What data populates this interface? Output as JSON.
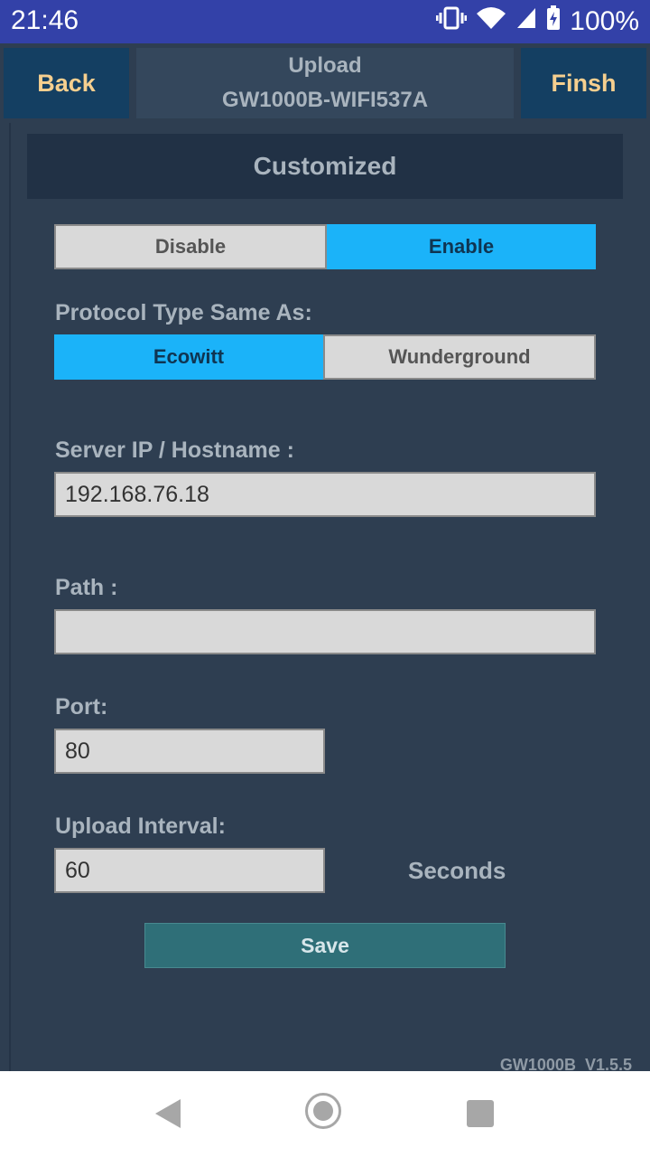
{
  "status_bar": {
    "time": "21:46",
    "battery": "100%"
  },
  "header": {
    "back_label": "Back",
    "title_line1": "Upload",
    "title_line2": "GW1000B-WIFI537A",
    "finish_label": "Finsh"
  },
  "section": {
    "title": "Customized"
  },
  "enable_toggle": {
    "disable_label": "Disable",
    "enable_label": "Enable",
    "selected": "Enable"
  },
  "protocol": {
    "label": "Protocol Type Same As:",
    "options": [
      "Ecowitt",
      "Wunderground"
    ],
    "selected": "Ecowitt"
  },
  "server": {
    "label": "Server IP / Hostname :",
    "value": "192.168.76.18"
  },
  "path": {
    "label": "Path :",
    "value": ""
  },
  "port": {
    "label": "Port:",
    "value": "80"
  },
  "interval": {
    "label": "Upload Interval:",
    "value": "60",
    "units": "Seconds"
  },
  "save_label": "Save",
  "version": "GW1000B_V1.5.5",
  "colors": {
    "accent": "#1bb3f9",
    "header_button": "#143f62",
    "header_text": "#f6cf8f",
    "background": "#2e3e51",
    "save": "#2f6f78"
  },
  "icons": [
    "vibrate-icon",
    "wifi-icon",
    "signal-icon",
    "battery-charging-icon",
    "back-nav-icon",
    "home-nav-icon",
    "recents-nav-icon"
  ]
}
